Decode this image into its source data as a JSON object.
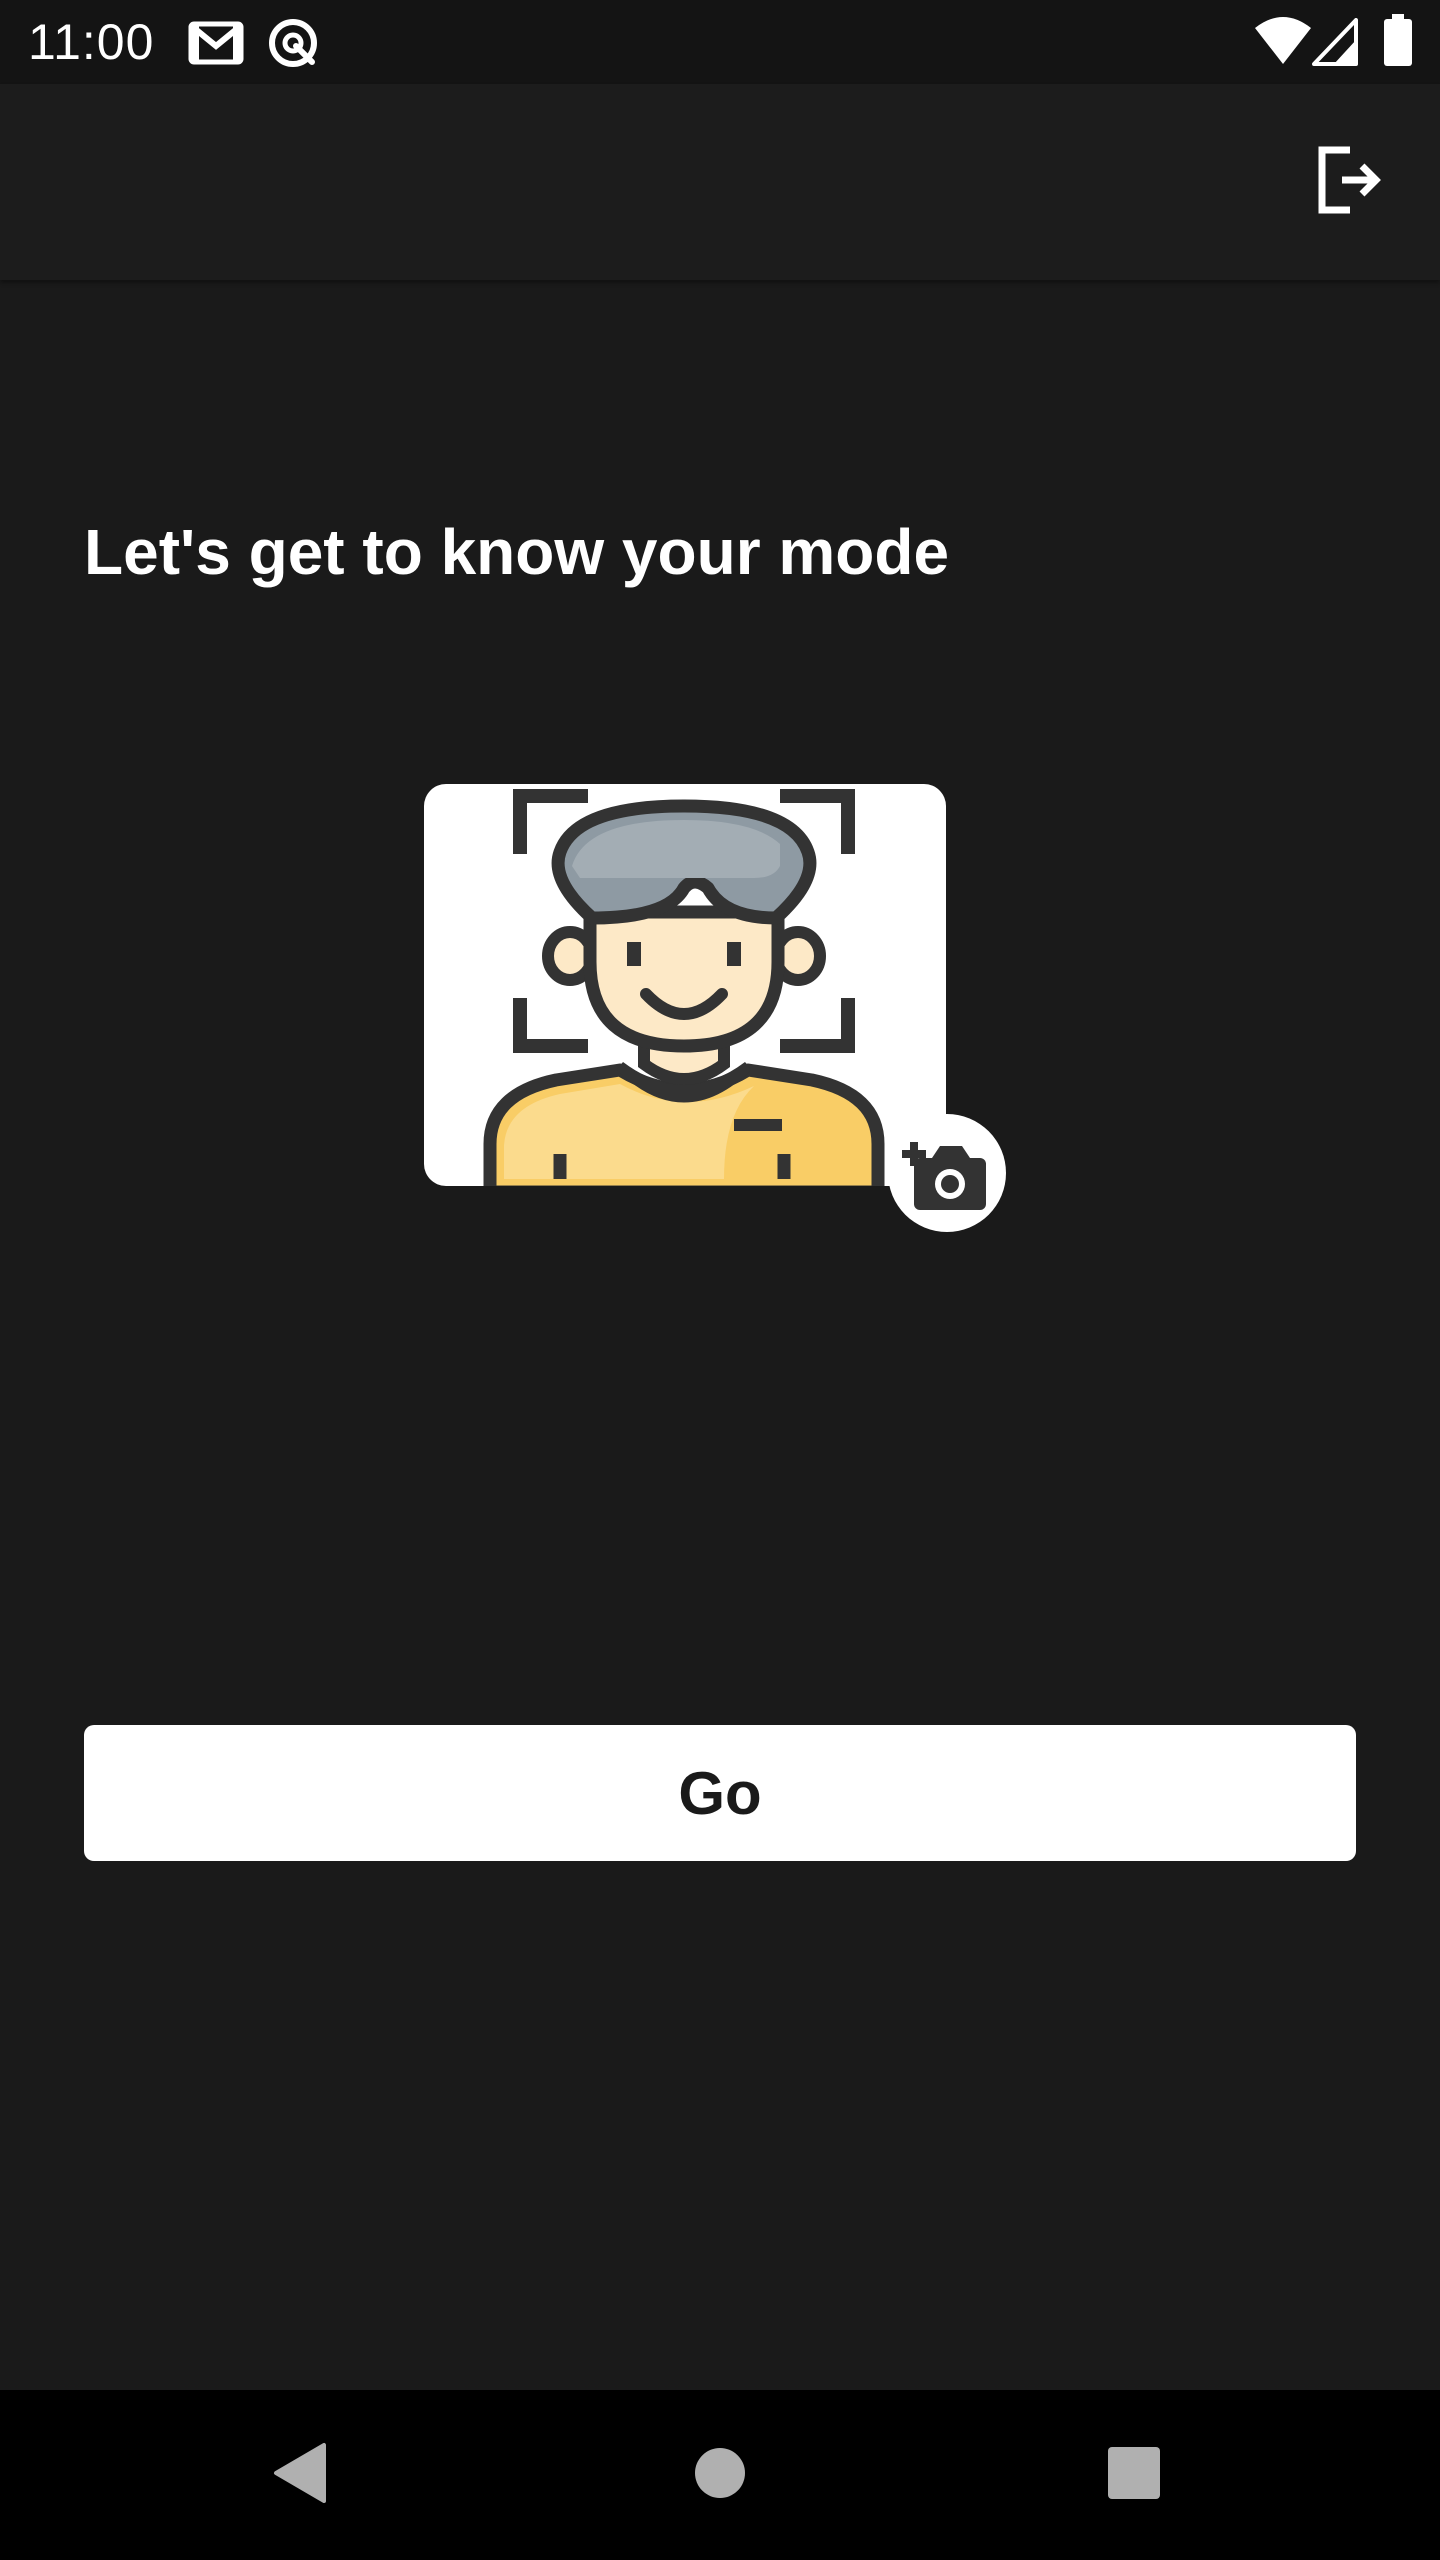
{
  "status_bar": {
    "time": "11:00",
    "icons": [
      "gmail-icon",
      "sync-icon",
      "wifi-icon",
      "cell-signal-icon",
      "battery-icon"
    ]
  },
  "app_bar": {
    "logout_icon": "logout-icon"
  },
  "main": {
    "title": "Let's get to know your mode",
    "illustration": "face-scan-avatar-illustration",
    "add_photo_icon": "add-camera-icon",
    "go_label": "Go"
  },
  "nav_bar": {
    "icons": [
      "back-icon",
      "home-icon",
      "recents-icon"
    ]
  },
  "colors": {
    "background": "#1a1a1a",
    "app_bar": "#1c1c1c",
    "status_bar": "#141414",
    "button": "#ffffff",
    "button_text": "#1a1a1a",
    "hair": "#8e9aa3",
    "skin": "#fde9c7",
    "shirt": "#f9cd66",
    "outline": "#333333"
  }
}
